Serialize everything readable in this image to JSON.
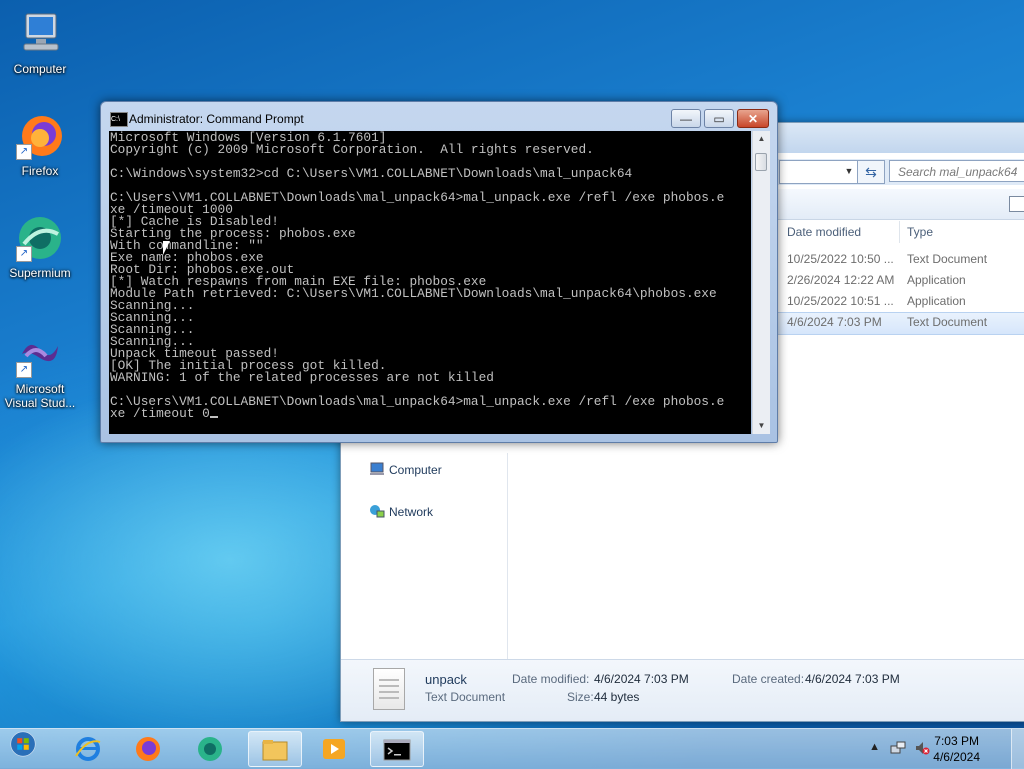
{
  "desktop": {
    "icons": [
      {
        "label": "Computer"
      },
      {
        "label": "Firefox"
      },
      {
        "label": "Supermium"
      },
      {
        "label": "Microsoft Visual Stud..."
      }
    ]
  },
  "explorer": {
    "search_placeholder": "Search mal_unpack64",
    "columns": {
      "date": "Date modified",
      "type": "Type"
    },
    "files": [
      {
        "date": "10/25/2022 10:50 ...",
        "type": "Text Document"
      },
      {
        "date": "2/26/2024 12:22 AM",
        "type": "Application"
      },
      {
        "date": "10/25/2022 10:51 ...",
        "type": "Application"
      },
      {
        "date": "4/6/2024 7:03 PM",
        "type": "Text Document"
      }
    ],
    "nav": {
      "computer": "Computer",
      "network": "Network"
    },
    "details": {
      "name": "unpack",
      "kind": "Text Document",
      "modified_label": "Date modified:",
      "modified_value": "4/6/2024 7:03 PM",
      "created_label": "Date created:",
      "created_value": "4/6/2024 7:03 PM",
      "size_label": "Size:",
      "size_value": "44 bytes"
    }
  },
  "cmd": {
    "title": "Administrator: Command Prompt",
    "output": "Microsoft Windows [Version 6.1.7601]\nCopyright (c) 2009 Microsoft Corporation.  All rights reserved.\n\nC:\\Windows\\system32>cd C:\\Users\\VM1.COLLABNET\\Downloads\\mal_unpack64\n\nC:\\Users\\VM1.COLLABNET\\Downloads\\mal_unpack64>mal_unpack.exe /refl /exe phobos.e\nxe /timeout 1000\n[*] Cache is Disabled!\nStarting the process: phobos.exe\nWith commandline: \"\"\nExe name: phobos.exe\nRoot Dir: phobos.exe.out\n[*] Watch respawns from main EXE file: phobos.exe\nModule Path retrieved: C:\\Users\\VM1.COLLABNET\\Downloads\\mal_unpack64\\phobos.exe\nScanning...\nScanning...\nScanning...\nScanning...\nUnpack timeout passed!\n[OK] The initial process got killed.\nWARNING: 1 of the related processes are not killed\n\nC:\\Users\\VM1.COLLABNET\\Downloads\\mal_unpack64>mal_unpack.exe /refl /exe phobos.e\nxe /timeout 0"
  },
  "taskbar": {
    "time": "7:03 PM",
    "date": "4/6/2024"
  }
}
